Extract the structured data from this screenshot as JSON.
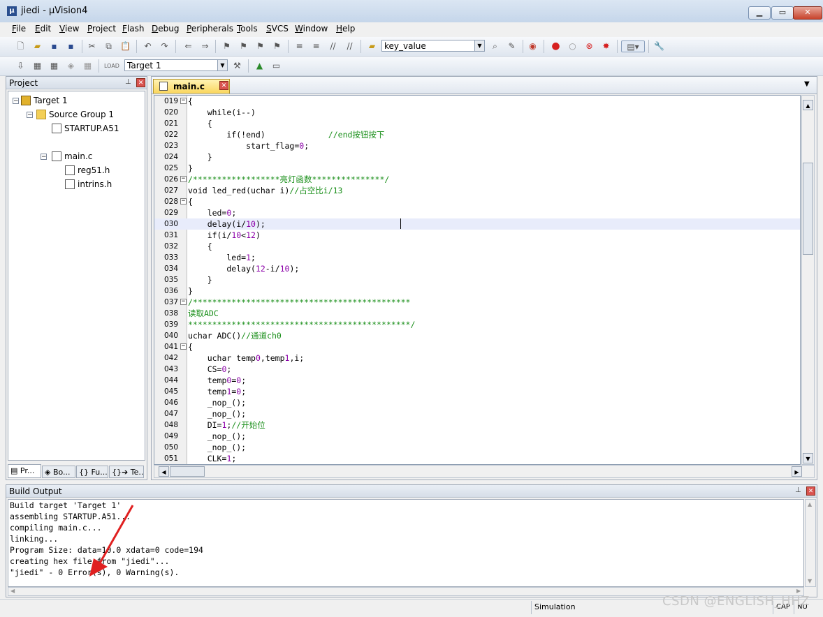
{
  "window": {
    "title": "jiedi  - µVision4"
  },
  "menu": [
    "File",
    "Edit",
    "View",
    "Project",
    "Flash",
    "Debug",
    "Peripherals",
    "Tools",
    "SVCS",
    "Window",
    "Help"
  ],
  "toolbar": {
    "find_combo": "key_value",
    "target_combo": "Target 1"
  },
  "project_panel": {
    "title": "Project",
    "tree": [
      "Target 1",
      "Source Group 1",
      "STARTUP.A51",
      "main.c",
      "reg51.h",
      "intrins.h"
    ],
    "tabs": [
      "Pr...",
      "Bo...",
      "Fu...",
      "Te..."
    ]
  },
  "editor": {
    "tab": "main.c",
    "lines": [
      {
        "n": "019",
        "t": "{"
      },
      {
        "n": "020",
        "t": "    while(i--)"
      },
      {
        "n": "021",
        "t": "    {"
      },
      {
        "n": "022",
        "t": "        if(!end)             ",
        "c": "//end按钮按下"
      },
      {
        "n": "023",
        "t": "            start_flag=0;"
      },
      {
        "n": "024",
        "t": "    }"
      },
      {
        "n": "025",
        "t": "}"
      },
      {
        "n": "026",
        "t": "",
        "c": "/******************亮灯函数***************/"
      },
      {
        "n": "027",
        "t": "void led_red(uchar i)",
        "c": "//占空比i/13"
      },
      {
        "n": "028",
        "t": "{"
      },
      {
        "n": "029",
        "t": "    led=0;"
      },
      {
        "n": "030",
        "t": "    delay(i/10);"
      },
      {
        "n": "031",
        "t": "    if(i/10<12)"
      },
      {
        "n": "032",
        "t": "    {"
      },
      {
        "n": "033",
        "t": "        led=1;"
      },
      {
        "n": "034",
        "t": "        delay(12-i/10);"
      },
      {
        "n": "035",
        "t": "    }"
      },
      {
        "n": "036",
        "t": "}"
      },
      {
        "n": "037",
        "t": "",
        "c": "/*********************************************"
      },
      {
        "n": "038",
        "t": "",
        "c": "读取ADC"
      },
      {
        "n": "039",
        "t": "",
        "c": "**********************************************/"
      },
      {
        "n": "040",
        "t": "uchar ADC()",
        "c": "//通道ch0"
      },
      {
        "n": "041",
        "t": "{"
      },
      {
        "n": "042",
        "t": "    uchar temp0,temp1,i;"
      },
      {
        "n": "043",
        "t": "    CS=0;"
      },
      {
        "n": "044",
        "t": "    temp0=0;"
      },
      {
        "n": "045",
        "t": "    temp1=0;"
      },
      {
        "n": "046",
        "t": "    _nop_();"
      },
      {
        "n": "047",
        "t": "    _nop_();"
      },
      {
        "n": "048",
        "t": "    DI=1;",
        "c": "//开始位"
      },
      {
        "n": "049",
        "t": "    _nop_();"
      },
      {
        "n": "050",
        "t": "    _nop_();"
      },
      {
        "n": "051",
        "t": "    CLK=1;"
      }
    ]
  },
  "build_output": {
    "title": "Build Output",
    "lines": [
      "Build target 'Target 1'",
      "assembling STARTUP.A51...",
      "compiling main.c...",
      "linking...",
      "Program Size: data=10.0 xdata=0 code=194",
      "creating hex file from \"jiedi\"...",
      "\"jiedi\" - 0 Error(s), 0 Warning(s)."
    ]
  },
  "status": {
    "mode": "Simulation",
    "cap": "CAP",
    "num": "NU"
  },
  "watermark": "CSDN @ENGLISH_HHZ"
}
